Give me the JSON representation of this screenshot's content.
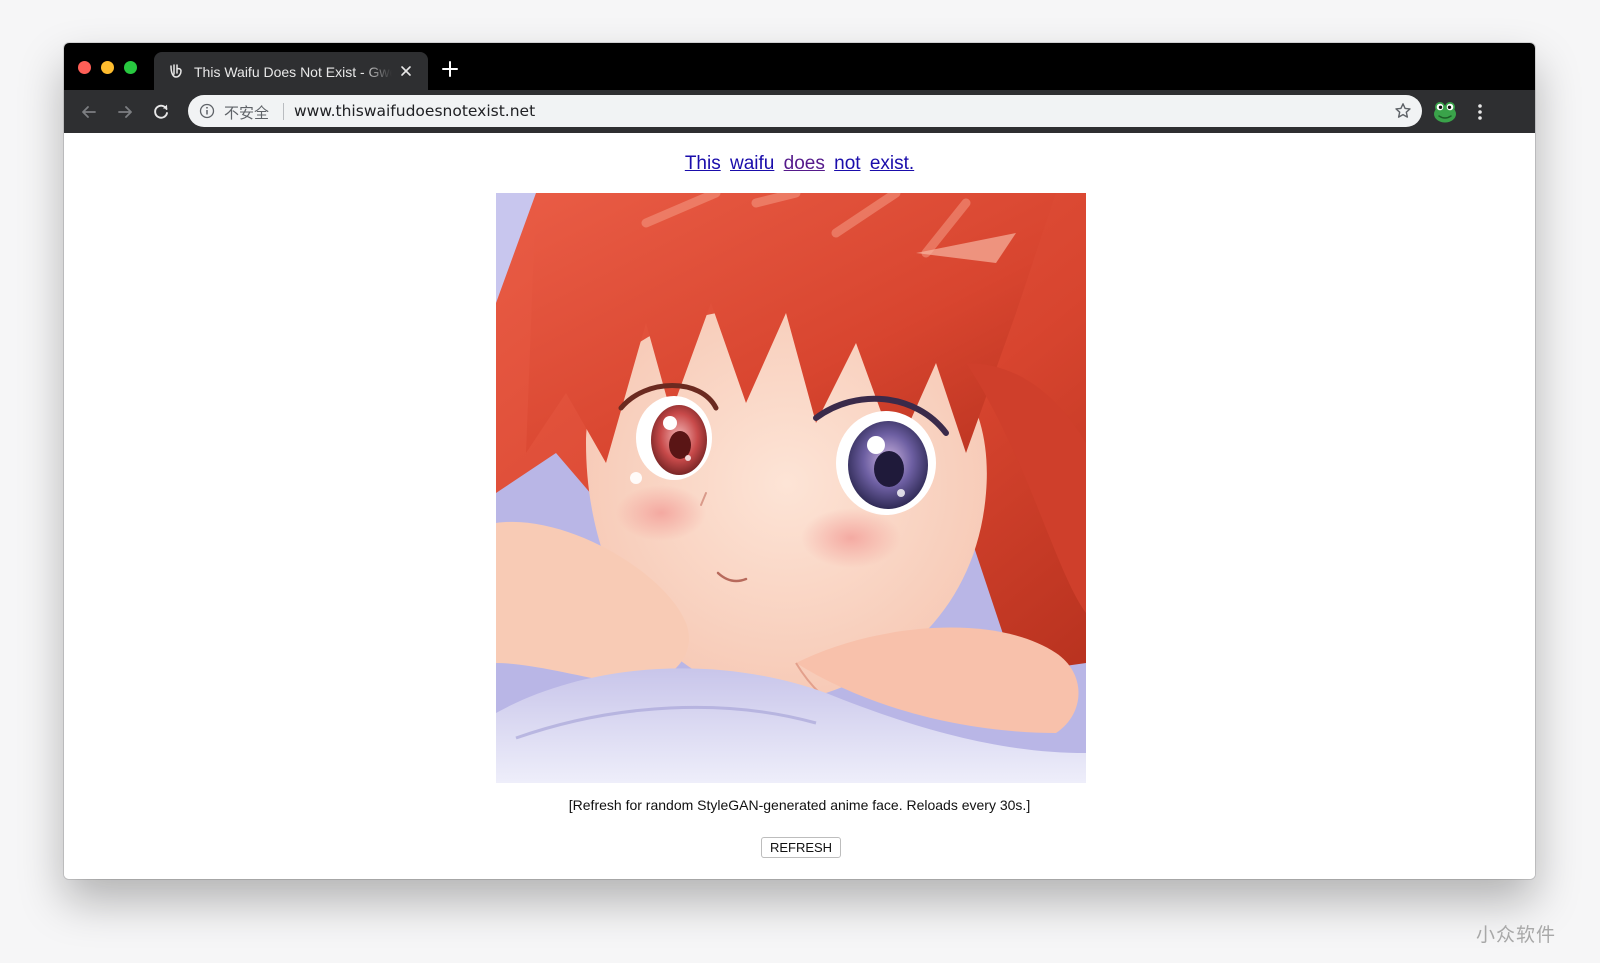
{
  "browser": {
    "tab_title": "This Waifu Does Not Exist - Gwern",
    "security_label": "不安全",
    "url": "www.thiswaifudoesnotexist.net"
  },
  "page": {
    "heading_words": [
      "This",
      "waifu",
      "does",
      "not",
      "exist."
    ],
    "caption": "[Refresh for random StyleGAN-generated anime face. Reloads every 30s.]",
    "refresh_label": "REFRESH"
  },
  "watermark": "小众软件",
  "colors": {
    "link": "#1a0dab",
    "visited_link": "#551a8b",
    "hair": "#d8452f",
    "tabstrip": "#000000",
    "toolbar": "#2e2f31"
  }
}
